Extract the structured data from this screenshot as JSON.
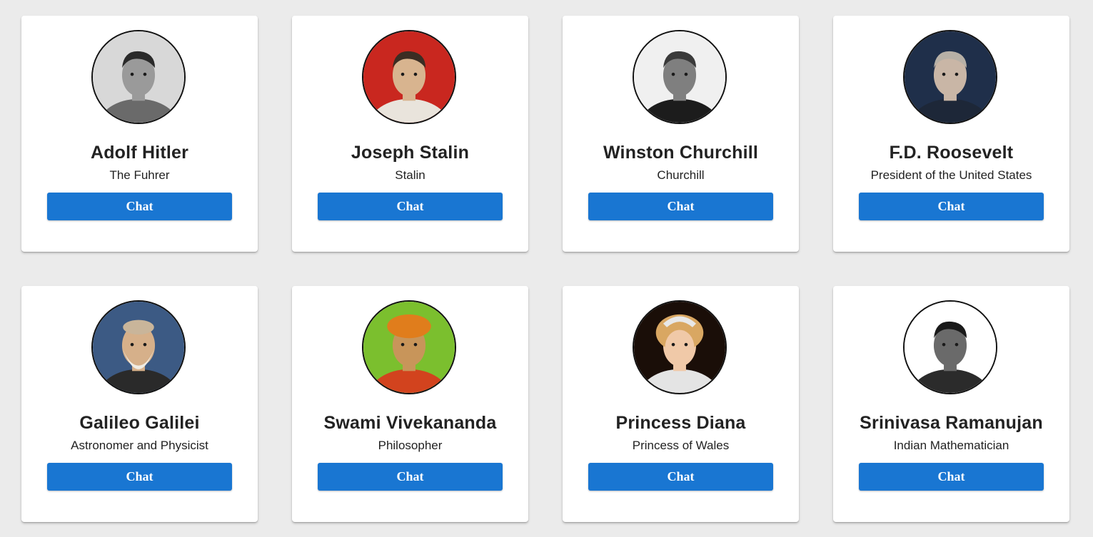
{
  "personas": [
    {
      "name": "Adolf Hitler",
      "title": "The Fuhrer",
      "button": "Chat",
      "portrait": "portrait-bw-man",
      "palette": {
        "bg": "#d8d8d8",
        "face": "#9a9a9a",
        "hair": "#2a2a2a",
        "cloth": "#6a6a6a"
      }
    },
    {
      "name": "Joseph Stalin",
      "title": "Stalin",
      "button": "Chat",
      "portrait": "portrait-uniform-red-flag",
      "palette": {
        "bg": "#c9271f",
        "face": "#d8b48f",
        "hair": "#3b2d23",
        "cloth": "#e9e4dc"
      }
    },
    {
      "name": "Winston Churchill",
      "title": "Churchill",
      "button": "Chat",
      "portrait": "portrait-bw-man",
      "palette": {
        "bg": "#f0f0f0",
        "face": "#7f7f7f",
        "hair": "#3a3a3a",
        "cloth": "#1c1c1c"
      }
    },
    {
      "name": "F.D. Roosevelt",
      "title": "President of the United States",
      "button": "Chat",
      "portrait": "portrait-suit-man",
      "palette": {
        "bg": "#1f2f4a",
        "face": "#c9b6a6",
        "hair": "#b7b0a6",
        "cloth": "#1d2738"
      }
    },
    {
      "name": "Galileo Galilei",
      "title": "Astronomer and Physicist",
      "button": "Chat",
      "portrait": "portrait-engraving-bearded",
      "palette": {
        "bg": "#3c5a84",
        "face": "#d6b08a",
        "hair": "#f0ece4",
        "cloth": "#2a2a2a"
      }
    },
    {
      "name": "Swami Vivekananda",
      "title": "Philosopher",
      "button": "Chat",
      "portrait": "portrait-turban",
      "palette": {
        "bg": "#7bbf2e",
        "face": "#c8955a",
        "hair": "#e07d1c",
        "cloth": "#d2431e"
      }
    },
    {
      "name": "Princess Diana",
      "title": "Princess of Wales",
      "button": "Chat",
      "portrait": "portrait-tiara",
      "palette": {
        "bg": "#1a0e08",
        "face": "#f0c9a8",
        "hair": "#d9a762",
        "cloth": "#e4e4e4"
      }
    },
    {
      "name": "Srinivasa Ramanujan",
      "title": "Indian Mathematician",
      "button": "Chat",
      "portrait": "portrait-bw-man",
      "palette": {
        "bg": "#ffffff",
        "face": "#6a6a6a",
        "hair": "#1a1a1a",
        "cloth": "#2b2b2b"
      }
    }
  ]
}
